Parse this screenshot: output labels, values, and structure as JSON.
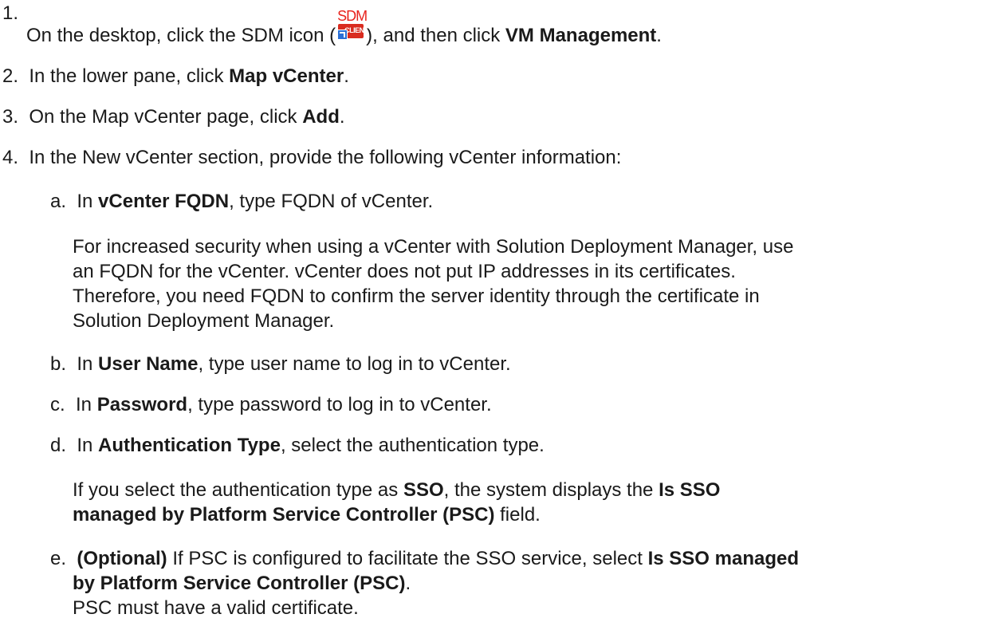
{
  "steps": [
    {
      "num": "1.",
      "pre": "On the desktop, click the SDM icon (",
      "icon": {
        "name": "sdm-client-icon",
        "top_text": "SDM",
        "badge_text": "CLIENT"
      },
      "mid": "), and then click ",
      "bold": "VM Management",
      "post": "."
    },
    {
      "num": "2.",
      "pre": "In the lower pane, click ",
      "bold": "Map vCenter",
      "post": "."
    },
    {
      "num": "3.",
      "pre": "On the Map vCenter page, click ",
      "bold": "Add",
      "post": "."
    },
    {
      "num": "4.",
      "text": "In the New vCenter section, provide the following vCenter information:"
    }
  ],
  "substeps": {
    "a": {
      "letter": "a.",
      "pre": "In ",
      "bold": "vCenter FQDN",
      "post": ", type FQDN of vCenter.",
      "note_lines": [
        "For increased security when using a vCenter with Solution Deployment Manager, use",
        "an FQDN for the vCenter. vCenter does not put IP addresses in its certificates.",
        "Therefore, you need FQDN to confirm the server identity through the certificate in",
        "Solution Deployment Manager."
      ]
    },
    "b": {
      "letter": "b.",
      "pre": "In ",
      "bold": "User Name",
      "post": ", type user name to log in to vCenter."
    },
    "c": {
      "letter": "c.",
      "pre": "In ",
      "bold": "Password",
      "post": ", type password to log in to vCenter."
    },
    "d": {
      "letter": "d.",
      "pre": "In ",
      "bold": "Authentication Type",
      "post": ", select the authentication type.",
      "note1_pre": "If you select the authentication type as ",
      "note1_bold1": "SSO",
      "note1_mid": ", the system displays the ",
      "note1_bold2": "Is SSO",
      "note2_bold": "managed by Platform Service Controller (PSC)",
      "note2_post": " field."
    },
    "e": {
      "letter": "e.",
      "bold_lead": "(Optional)",
      "pre": " If PSC is configured to facilitate the SSO service, select ",
      "bold1": "Is SSO managed",
      "bold2": "by Platform Service Controller (PSC)",
      "post": ".",
      "note": "PSC must have a valid certificate."
    }
  }
}
